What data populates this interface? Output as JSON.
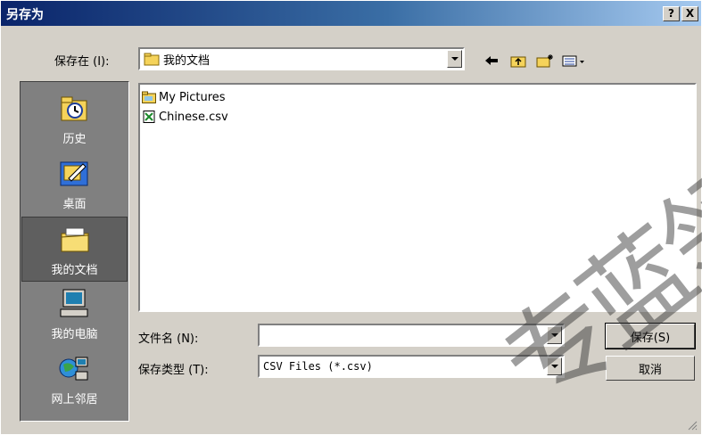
{
  "window": {
    "title": "另存为",
    "help_label": "?",
    "close_label": "X"
  },
  "save_in": {
    "label": "保存在 (I):",
    "value": "我的文档"
  },
  "toolbar": {
    "icons": [
      "back-arrow-icon",
      "up-folder-icon",
      "new-folder-icon",
      "view-menu-icon"
    ]
  },
  "places": [
    {
      "label": "历史",
      "icon": "history-icon"
    },
    {
      "label": "桌面",
      "icon": "desktop-icon"
    },
    {
      "label": "我的文档",
      "icon": "my-documents-icon",
      "selected": true
    },
    {
      "label": "我的电脑",
      "icon": "my-computer-icon"
    },
    {
      "label": "网上邻居",
      "icon": "network-neighborhood-icon"
    }
  ],
  "files": [
    {
      "name": "My Pictures",
      "icon": "folder-icon"
    },
    {
      "name": "Chinese.csv",
      "icon": "csv-file-icon"
    }
  ],
  "file_name": {
    "label": "文件名 (N):",
    "value": ""
  },
  "file_type": {
    "label": "保存类型 (T):",
    "value": "CSV Files (*.csv)"
  },
  "buttons": {
    "save": "保存(S)",
    "cancel": "取消"
  },
  "watermark": "专蓝领"
}
